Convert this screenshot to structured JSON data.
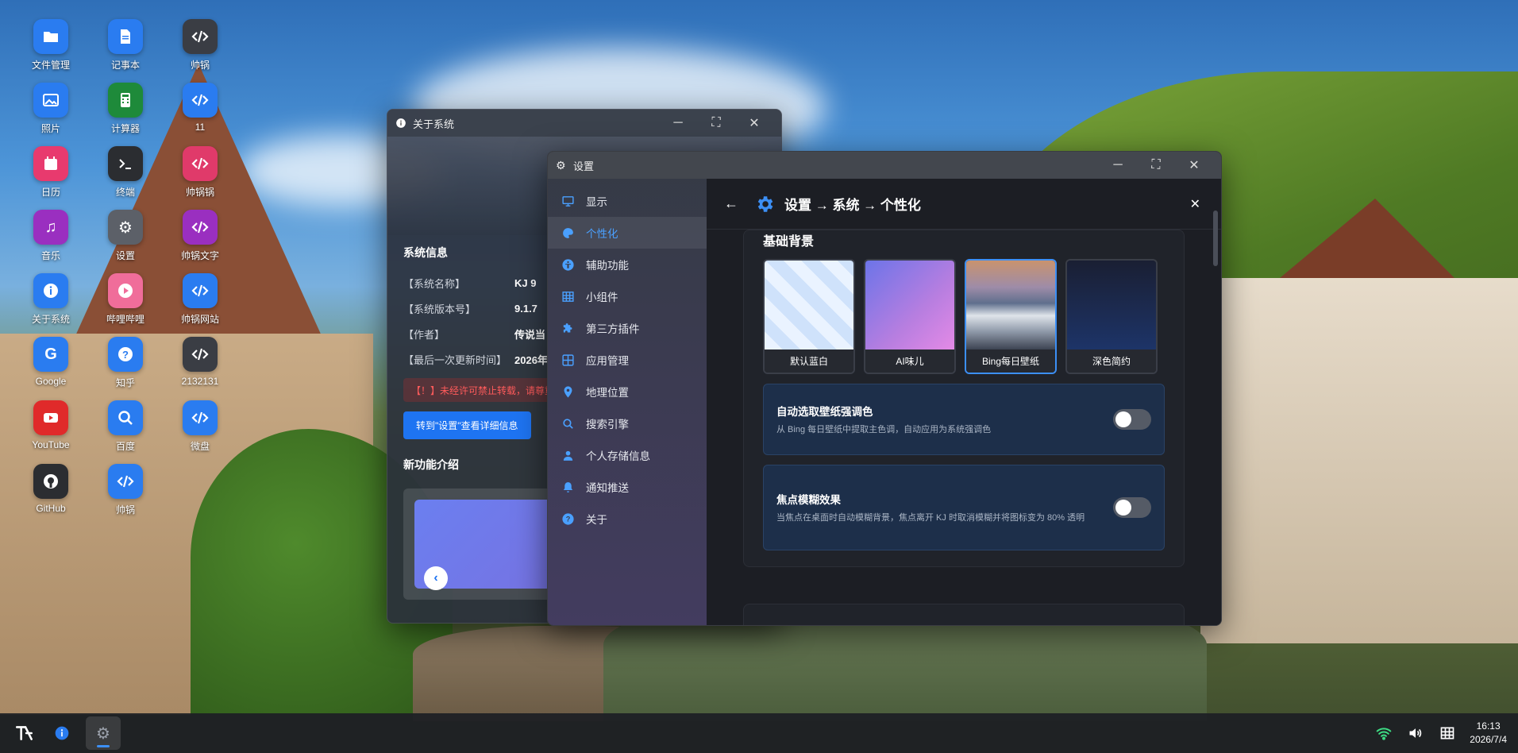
{
  "desktop": {
    "icons": [
      {
        "label": "文件管理",
        "color": "#2a7cf0",
        "icon": "folder-icon"
      },
      {
        "label": "记事本",
        "color": "#2a7cf0",
        "icon": "notepad-icon"
      },
      {
        "label": "帅锅",
        "color": "#3a3d44",
        "icon": "code-icon"
      },
      {
        "label": "照片",
        "color": "#2a7cf0",
        "icon": "photo-icon"
      },
      {
        "label": "计算器",
        "color": "#1e8a3a",
        "icon": "calculator-icon"
      },
      {
        "label": "11",
        "color": "#2a7cf0",
        "icon": "code-icon"
      },
      {
        "label": "日历",
        "color": "#e83a6e",
        "icon": "calendar-icon"
      },
      {
        "label": "终端",
        "color": "#2b2d31",
        "icon": "terminal-icon"
      },
      {
        "label": "帅锅锅",
        "color": "#e03a6a",
        "icon": "code-icon"
      },
      {
        "label": "音乐",
        "color": "#9a2fc0",
        "icon": "music-icon"
      },
      {
        "label": "设置",
        "color": "#5c6068",
        "icon": "gear-icon"
      },
      {
        "label": "帅锅文字",
        "color": "#9a2fc0",
        "icon": "code-icon"
      },
      {
        "label": "关于系统",
        "color": "#2a7cf0",
        "icon": "info-icon"
      },
      {
        "label": "哔哩哔哩",
        "color": "#f06d9a",
        "icon": "play-icon"
      },
      {
        "label": "帅锅网站",
        "color": "#2a7cf0",
        "icon": "code-icon"
      },
      {
        "label": "Google",
        "color": "#2a7cf0",
        "icon": "google-icon"
      },
      {
        "label": "知乎",
        "color": "#2a7cf0",
        "icon": "question-icon"
      },
      {
        "label": "2132131",
        "color": "#3a3d44",
        "icon": "code-icon"
      },
      {
        "label": "YouTube",
        "color": "#e02a2a",
        "icon": "youtube-icon"
      },
      {
        "label": "百度",
        "color": "#2a7cf0",
        "icon": "search-icon"
      },
      {
        "label": "微盘",
        "color": "#2a7cf0",
        "icon": "code-icon"
      },
      {
        "label": "GitHub",
        "color": "#2b2d31",
        "icon": "github-icon"
      },
      {
        "label": "帅锅",
        "color": "#2a7cf0",
        "icon": "code-icon"
      }
    ]
  },
  "about_window": {
    "title": "关于系统",
    "section_title": "系统信息",
    "rows": [
      {
        "key": "【系统名称】",
        "value": "KJ 9"
      },
      {
        "key": "【系统版本号】",
        "value": "9.1.7"
      },
      {
        "key": "【作者】",
        "value": "传说当"
      },
      {
        "key": "【最后一次更新时间】",
        "value": "2026年"
      }
    ],
    "warning": "【！】未经许可禁止转载，请尊重",
    "goto_button": "转到\"设置\"查看详细信息",
    "feature_title": "新功能介绍"
  },
  "settings_window": {
    "title": "设置",
    "breadcrumb": "设置 → 系统 → 个性化",
    "sidebar": [
      {
        "label": "显示",
        "icon": "monitor-icon",
        "active": false
      },
      {
        "label": "个性化",
        "icon": "palette-icon",
        "active": true
      },
      {
        "label": "辅助功能",
        "icon": "accessibility-icon",
        "active": false
      },
      {
        "label": "小组件",
        "icon": "grid-icon",
        "active": false
      },
      {
        "label": "第三方插件",
        "icon": "puzzle-icon",
        "active": false
      },
      {
        "label": "应用管理",
        "icon": "apps-icon",
        "active": false
      },
      {
        "label": "地理位置",
        "icon": "location-icon",
        "active": false
      },
      {
        "label": "搜索引擎",
        "icon": "search-icon",
        "active": false
      },
      {
        "label": "个人存储信息",
        "icon": "person-icon",
        "active": false
      },
      {
        "label": "通知推送",
        "icon": "bell-icon",
        "active": false
      },
      {
        "label": "关于",
        "icon": "help-icon",
        "active": false
      }
    ],
    "group_title": "基础背景",
    "wallpapers": [
      {
        "label": "默认蓝白",
        "selected": false
      },
      {
        "label": "AI味儿",
        "selected": false
      },
      {
        "label": "Bing每日壁纸",
        "selected": true
      },
      {
        "label": "深色简约",
        "selected": false
      }
    ],
    "options": [
      {
        "title": "自动选取壁纸强调色",
        "desc": "从 Bing 每日壁纸中提取主色调，自动应用为系统强调色",
        "enabled": false
      },
      {
        "title": "焦点模糊效果",
        "desc": "当焦点在桌面时自动模糊背景，焦点离开 KJ 时取消模糊并将图标变为 80% 透明",
        "enabled": false
      }
    ]
  },
  "taskbar": {
    "time": "16:13",
    "date": "2026/7/4"
  }
}
